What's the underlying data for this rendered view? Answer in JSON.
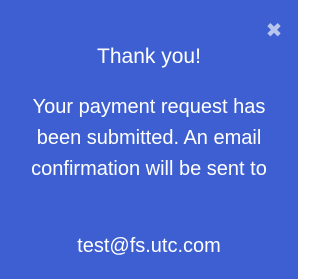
{
  "dialog": {
    "close_icon": "close-icon",
    "close_glyph": "✖",
    "title": "Thank you!",
    "message": "Your payment request has been submitted. An email confirmation will be sent to",
    "email": "test@fs.utc.com"
  },
  "colors": {
    "background": "#3d5fd1",
    "text": "#ffffff",
    "close_icon": "#b8c6ee"
  }
}
